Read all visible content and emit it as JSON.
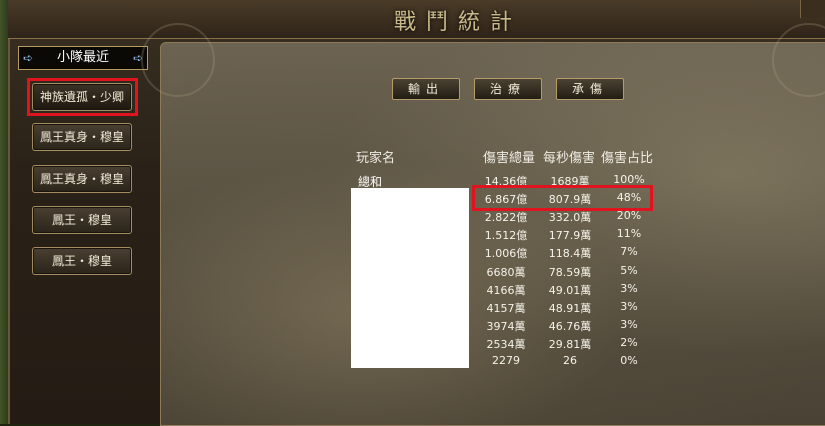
{
  "window": {
    "title": "戰鬥統計"
  },
  "team": {
    "header": "小隊最近",
    "members": [
      "神族遺孤・少卿",
      "鳳王真身・穆皇",
      "鳳王真身・穆皇",
      "鳳王・穆皇",
      "鳳王・穆皇"
    ]
  },
  "tabs": [
    "輸出",
    "治療",
    "承傷"
  ],
  "table": {
    "headers": {
      "player": "玩家名",
      "total": "傷害總量",
      "dps": "每秒傷害",
      "share": "傷害占比"
    },
    "total_label": "總和",
    "rows": [
      {
        "total": "14.36億",
        "dps": "1689萬",
        "share": "100%"
      },
      {
        "total": "6.867億",
        "dps": "807.9萬",
        "share": "48%"
      },
      {
        "total": "2.822億",
        "dps": "332.0萬",
        "share": "20%"
      },
      {
        "total": "1.512億",
        "dps": "177.9萬",
        "share": "11%"
      },
      {
        "total": "1.006億",
        "dps": "118.4萬",
        "share": "7%"
      },
      {
        "total": "6680萬",
        "dps": "78.59萬",
        "share": "5%"
      },
      {
        "total": "4166萬",
        "dps": "49.01萬",
        "share": "3%"
      },
      {
        "total": "4157萬",
        "dps": "48.91萬",
        "share": "3%"
      },
      {
        "total": "3974萬",
        "dps": "46.76萬",
        "share": "3%"
      },
      {
        "total": "2534萬",
        "dps": "29.81萬",
        "share": "2%"
      },
      {
        "total": "2279",
        "dps": "26",
        "share": "0%"
      }
    ]
  }
}
